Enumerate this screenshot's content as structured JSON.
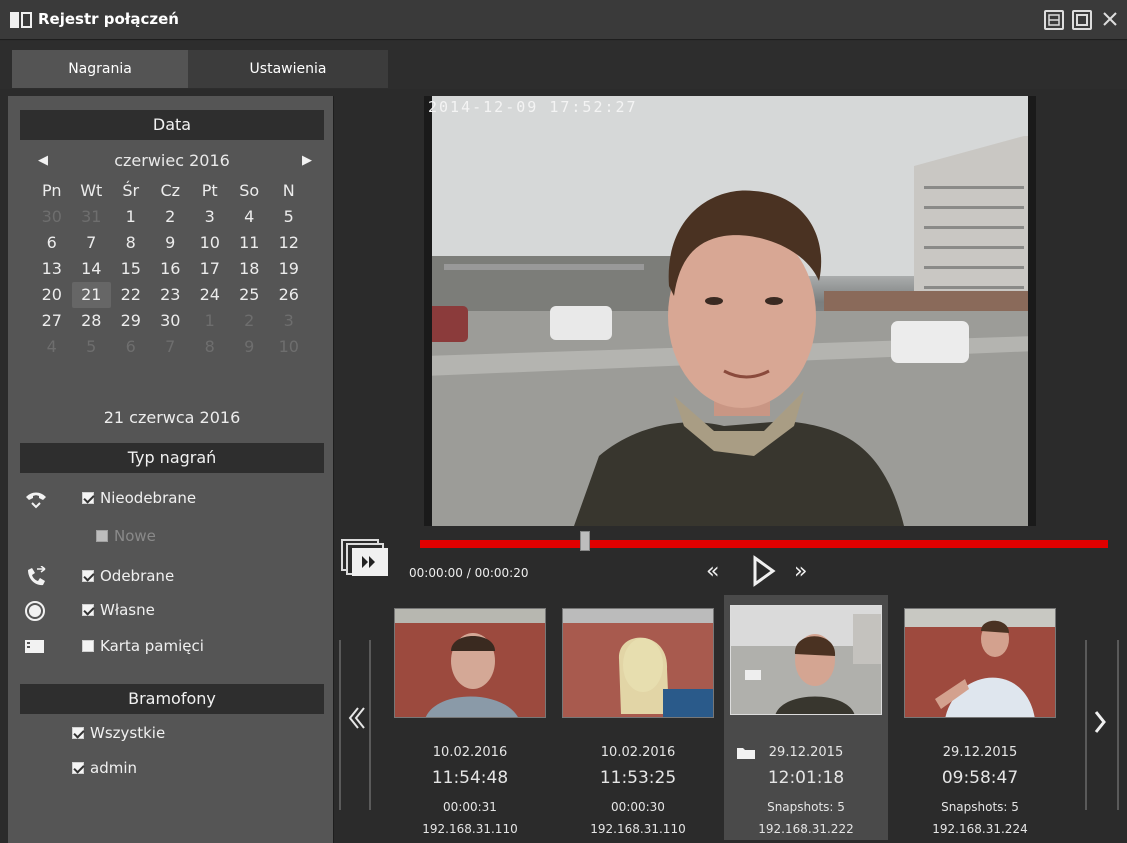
{
  "window": {
    "title": "Rejestr połączeń",
    "buttons": [
      "⊟",
      "☐",
      "✕"
    ]
  },
  "tabs": [
    {
      "label": "Nagrania",
      "active": true
    },
    {
      "label": "Ustawienia",
      "active": false
    }
  ],
  "calendar": {
    "header": "Data",
    "month_label": "czerwiec 2016",
    "weekdays": [
      "Pn",
      "Wt",
      "Śr",
      "Cz",
      "Pt",
      "So",
      "N"
    ],
    "weeks": [
      [
        "30",
        "31",
        "1",
        "2",
        "3",
        "4",
        "5"
      ],
      [
        "6",
        "7",
        "8",
        "9",
        "10",
        "11",
        "12"
      ],
      [
        "13",
        "14",
        "15",
        "16",
        "17",
        "18",
        "19"
      ],
      [
        "20",
        "21",
        "22",
        "23",
        "24",
        "25",
        "26"
      ],
      [
        "27",
        "28",
        "29",
        "30",
        "1",
        "2",
        "3"
      ],
      [
        "4",
        "5",
        "6",
        "7",
        "8",
        "9",
        "10"
      ]
    ],
    "selected_day": "21",
    "selected_date": "21 czerwca 2016"
  },
  "record_types": {
    "header": "Typ nagrań",
    "items": [
      {
        "label": "Nieodebrane",
        "checked": true,
        "icon": "missed-call-icon"
      },
      {
        "label": "Nowe",
        "checked": false,
        "disabled": true
      },
      {
        "label": "Odebrane",
        "checked": true,
        "icon": "answered-call-icon"
      },
      {
        "label": "Własne",
        "checked": true,
        "icon": "own-recording-icon"
      },
      {
        "label": "Karta pamięci",
        "checked": false,
        "icon": "memory-card-icon"
      }
    ]
  },
  "intercoms": {
    "header": "Bramofony",
    "items": [
      {
        "label": "Wszystkie",
        "checked": true
      },
      {
        "label": "admin",
        "checked": true
      }
    ]
  },
  "player": {
    "osd_timestamp": "2014-12-09 17:52:27",
    "timecode": "00:00:00 / 00:00:20",
    "progress_fraction": 0.24,
    "controls": [
      "«",
      "▶",
      "»"
    ],
    "accent_color": "#e00000"
  },
  "thumbnails": [
    {
      "date": "10.02.2016",
      "time": "11:54:48",
      "info": "00:00:31",
      "ip": "192.168.31.110",
      "active": false
    },
    {
      "date": "10.02.2016",
      "time": "11:53:25",
      "info": "00:00:30",
      "ip": "192.168.31.110",
      "active": false
    },
    {
      "date": "29.12.2015",
      "time": "12:01:18",
      "info": "Snapshots: 5",
      "ip": "192.168.31.222",
      "active": true,
      "folder_icon": true
    },
    {
      "date": "29.12.2015",
      "time": "09:58:47",
      "info": "Snapshots: 5",
      "ip": "192.168.31.224",
      "active": false
    }
  ],
  "nav": {
    "prev": "«",
    "next": "›"
  }
}
